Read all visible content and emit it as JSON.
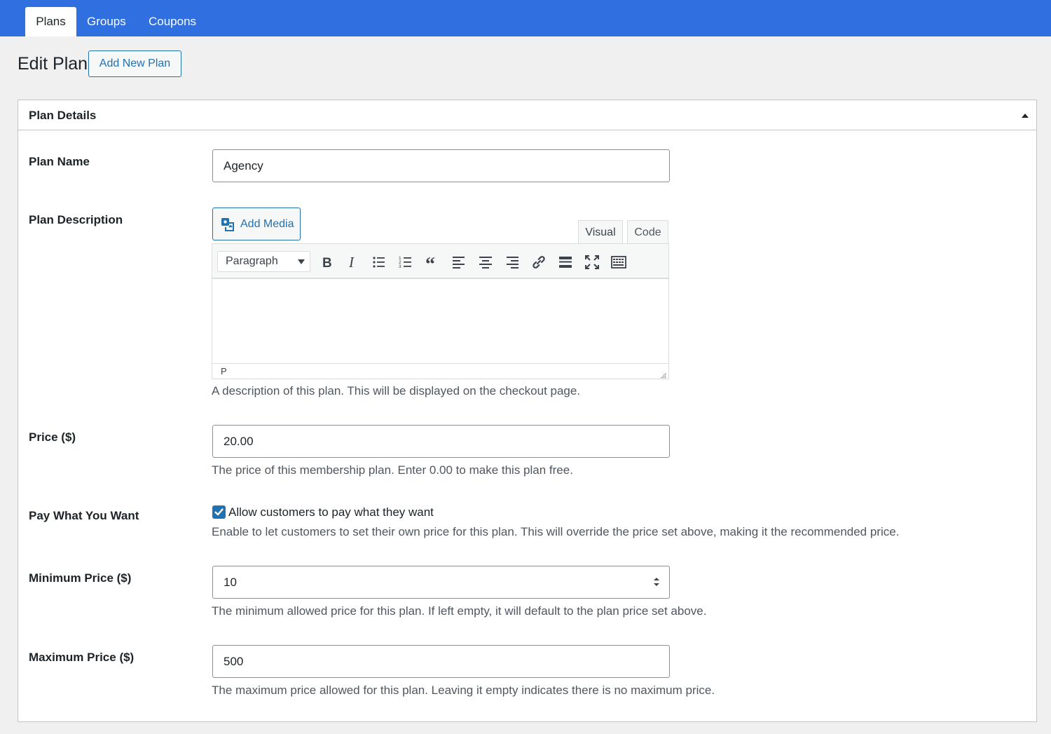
{
  "nav": {
    "tabs": [
      {
        "label": "Plans",
        "active": true
      },
      {
        "label": "Groups",
        "active": false
      },
      {
        "label": "Coupons",
        "active": false
      }
    ]
  },
  "header": {
    "title": "Edit Plan",
    "add_new_label": "Add New Plan"
  },
  "panel": {
    "title": "Plan Details",
    "toggle_icon": "triangle-up-icon"
  },
  "fields": {
    "plan_name": {
      "label": "Plan Name",
      "value": "Agency"
    },
    "plan_description": {
      "label": "Plan Description",
      "add_media_label": "Add Media",
      "editor_tabs": [
        "Visual",
        "Code"
      ],
      "active_editor_tab": "Visual",
      "format_select": "Paragraph",
      "toolbar_icons": [
        "bold-icon",
        "italic-icon",
        "bullet-list-icon",
        "numbered-list-icon",
        "blockquote-icon",
        "align-left-icon",
        "align-center-icon",
        "align-right-icon",
        "link-icon",
        "read-more-icon",
        "fullscreen-icon",
        "toolbar-toggle-icon"
      ],
      "content": "",
      "path": "P",
      "help": "A description of this plan. This will be displayed on the checkout page."
    },
    "price": {
      "label": "Price ($)",
      "value": "20.00",
      "help": "The price of this membership plan. Enter 0.00 to make this plan free."
    },
    "pay_what_you_want": {
      "label": "Pay What You Want",
      "checkbox_label": "Allow customers to pay what they want",
      "checked": true,
      "help": "Enable to let customers to set their own price for this plan. This will override the price set above, making it the recommended price."
    },
    "minimum_price": {
      "label": "Minimum Price ($)",
      "value": "10",
      "help": "The minimum allowed price for this plan. If left empty, it will default to the plan price set above."
    },
    "maximum_price": {
      "label": "Maximum Price ($)",
      "value": "500",
      "help": "The maximum price allowed for this plan. Leaving it empty indicates there is no maximum price."
    }
  },
  "colors": {
    "topbar": "#2f6fe0",
    "accent": "#2271b1",
    "background": "#f0f0f1"
  }
}
